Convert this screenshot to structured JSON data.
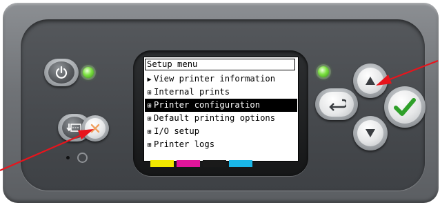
{
  "lcd": {
    "title": "Setup menu",
    "items": [
      {
        "marker": "▶",
        "label": "View printer information",
        "selected": false
      },
      {
        "marker": "⊞",
        "label": "Internal prints",
        "selected": false
      },
      {
        "marker": "⊞",
        "label": "Printer configuration",
        "selected": true
      },
      {
        "marker": "⊞",
        "label": "Default printing options",
        "selected": false
      },
      {
        "marker": "⊞",
        "label": "I/O setup",
        "selected": false
      },
      {
        "marker": "⊞",
        "label": "Printer logs",
        "selected": false
      }
    ]
  },
  "ink_colors": [
    "#f2e900",
    "#e2159b",
    "#1a1a1a",
    "#1ab7e8"
  ],
  "icons": {
    "power": "power-icon",
    "form_feed": "form-feed-cut-icon",
    "cancel": "cancel-x-icon",
    "back": "back-arrow-icon",
    "up": "up-arrow-icon",
    "down": "down-arrow-icon",
    "ok": "check-icon"
  },
  "colors": {
    "led_green": "#7be040",
    "check_green": "#2fa02a",
    "cancel_orange": "#f0a060",
    "arrow_red": "#e8141c"
  }
}
